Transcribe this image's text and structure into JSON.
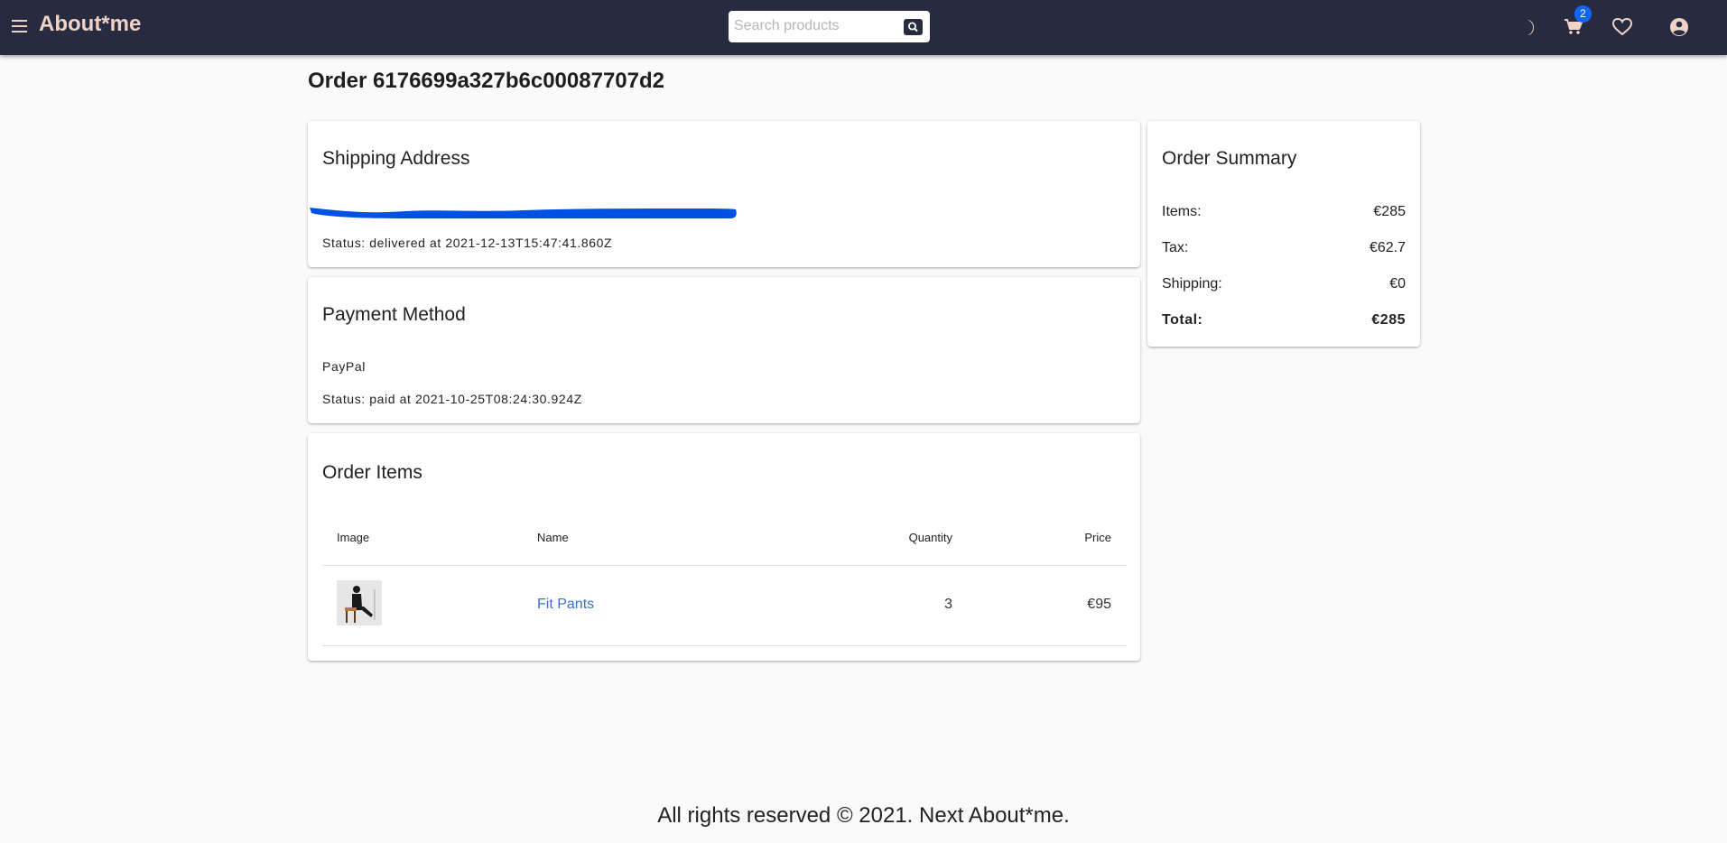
{
  "header": {
    "brand": "About*me",
    "search_placeholder": "Search products",
    "cart_count": "2",
    "icons": [
      "menu-icon",
      "search-icon",
      "dark-mode-icon",
      "cart-icon",
      "heart-icon",
      "account-icon"
    ],
    "colors": {
      "appbar": "#272b40",
      "brand": "#f1d2c6",
      "badge": "#1565f5"
    }
  },
  "page": {
    "title": "Order 6176699a327b6c00087707d2"
  },
  "shipping": {
    "title": "Shipping Address",
    "status": "Status: delivered at 2021-12-13T15:47:41.860Z",
    "redaction_color": "#0050e6"
  },
  "payment": {
    "title": "Payment Method",
    "method": "PayPal",
    "status": "Status: paid at 2021-10-25T08:24:30.924Z"
  },
  "items": {
    "title": "Order Items",
    "columns": [
      "Image",
      "Name",
      "Quantity",
      "Price"
    ],
    "rows": [
      {
        "name": "Fit Pants",
        "quantity": "3",
        "price": "€95"
      }
    ]
  },
  "summary": {
    "title": "Order Summary",
    "rows": [
      {
        "label": "Items:",
        "value": "€285"
      },
      {
        "label": "Tax:",
        "value": "€62.7"
      },
      {
        "label": "Shipping:",
        "value": "€0"
      },
      {
        "label": "Total:",
        "value": "€285"
      }
    ]
  },
  "footer": {
    "text": "All rights reserved © 2021. Next About*me."
  }
}
